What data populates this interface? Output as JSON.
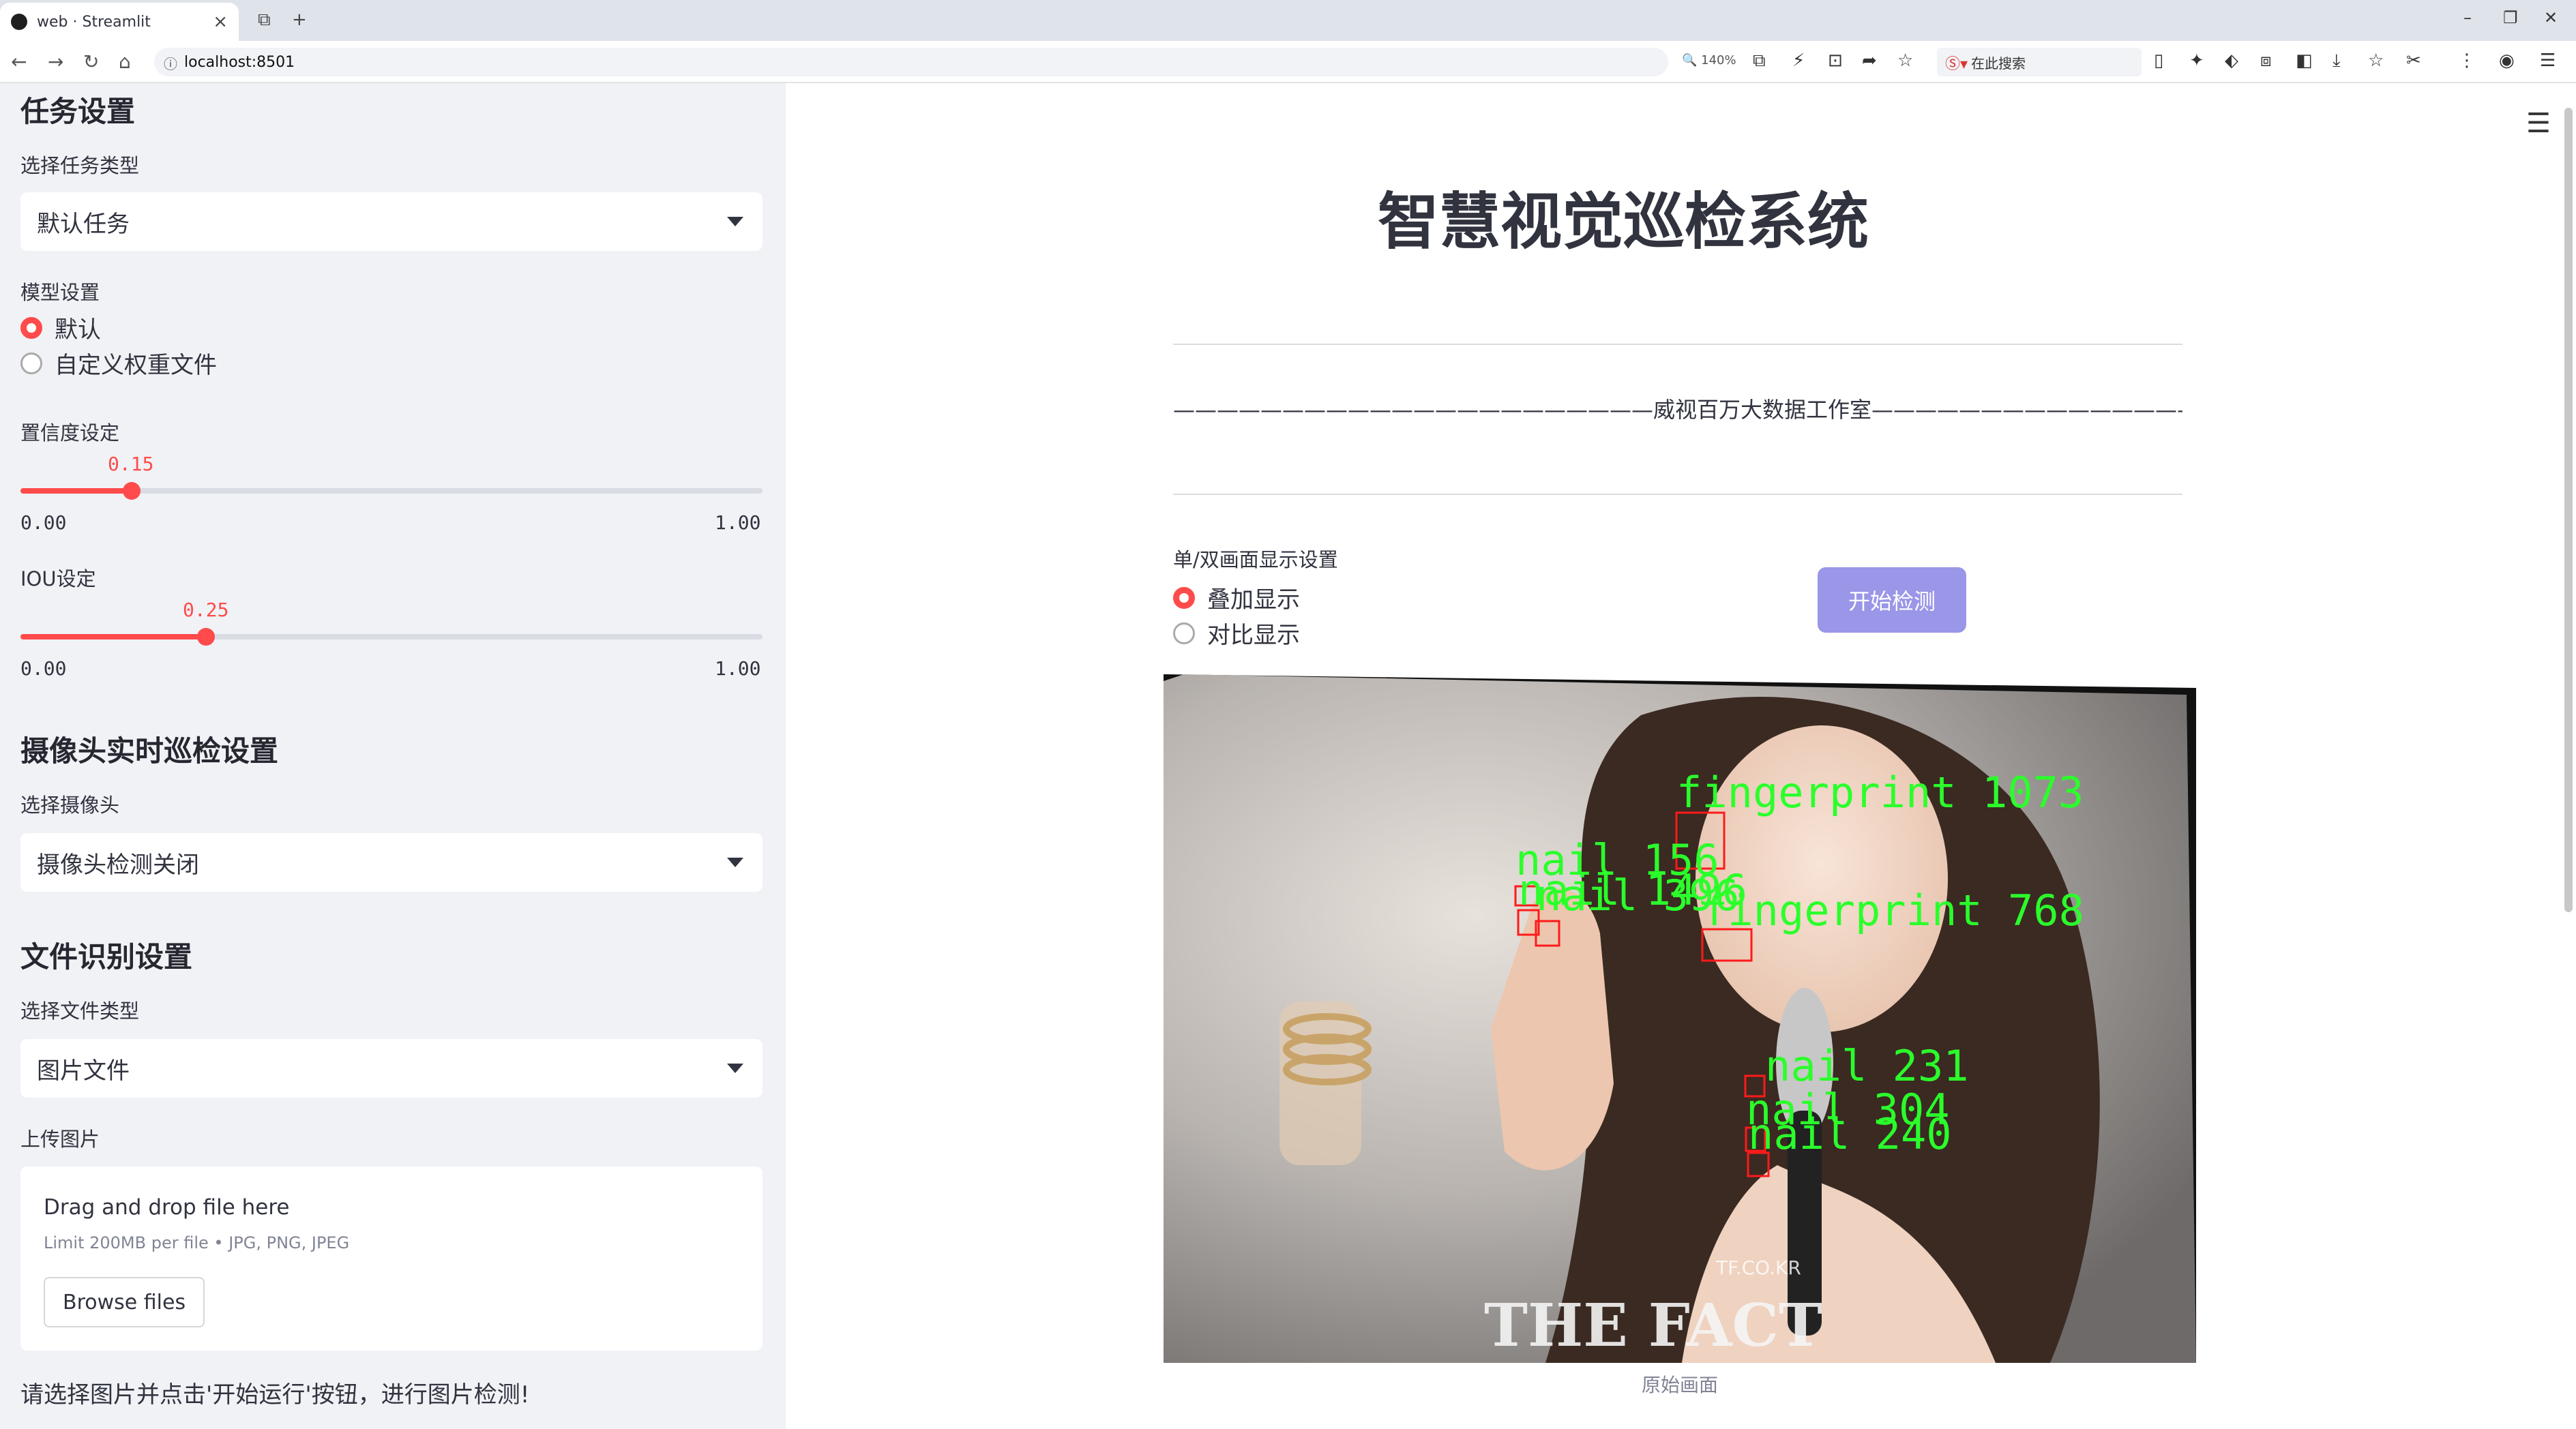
{
  "browser": {
    "tab_title": "web · Streamlit",
    "url": "localhost:8501",
    "zoom": "140%",
    "search_placeholder": "在此搜索"
  },
  "sidebar": {
    "task_section_title": "任务设置",
    "task_type_label": "选择任务类型",
    "task_type_value": "默认任务",
    "model_label": "模型设置",
    "model_options": [
      "默认",
      "自定义权重文件"
    ],
    "model_selected": "默认",
    "conf_label": "置信度设定",
    "conf_value": "0.15",
    "conf_min": "0.00",
    "conf_max": "1.00",
    "iou_label": "IOU设定",
    "iou_value": "0.25",
    "iou_min": "0.00",
    "iou_max": "1.00",
    "camera_section_title": "摄像头实时巡检设置",
    "camera_label": "选择摄像头",
    "camera_value": "摄像头检测关闭",
    "file_section_title": "文件识别设置",
    "file_type_label": "选择文件类型",
    "file_type_value": "图片文件",
    "upload_label": "上传图片",
    "upload_drag_text": "Drag and drop file here",
    "upload_limit_text": "Limit 200MB per file • JPG, PNG, JPEG",
    "browse_button": "Browse files",
    "hint_text": "请选择图片并点击'开始运行'按钮，进行图片检测!"
  },
  "main": {
    "title": "智慧视觉巡检系统",
    "studio_line": "——————————————————————威视百万大数据工作室————————————————————————",
    "display_label": "单/双画面显示设置",
    "display_options": [
      "叠加显示",
      "对比显示"
    ],
    "display_selected": "叠加显示",
    "start_button": "开始检测",
    "image_caption": "原始画面",
    "watermark": "THE FACT",
    "watermark_small": "TF.CO.KR",
    "detections": [
      {
        "label": "fingerprint",
        "id": "1073"
      },
      {
        "label": "nail",
        "id": "156"
      },
      {
        "label": "nail",
        "id": "1496"
      },
      {
        "label": "nail",
        "id": "396"
      },
      {
        "label": "fingerprint",
        "id": "768"
      },
      {
        "label": "nail",
        "id": "231"
      },
      {
        "label": "nail",
        "id": "304"
      },
      {
        "label": "nail",
        "id": "240"
      }
    ]
  }
}
